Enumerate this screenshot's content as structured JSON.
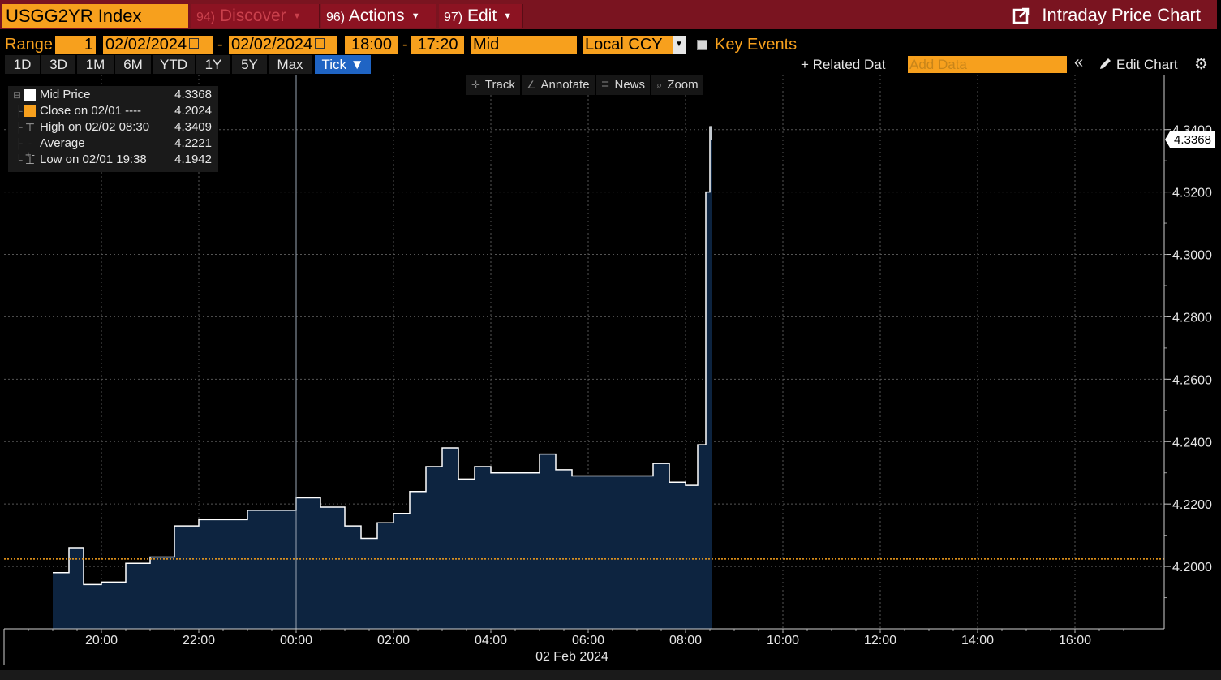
{
  "security": "USGG2YR Index",
  "menu": {
    "discover_num": "94)",
    "discover_label": "Discover",
    "actions_num": "96)",
    "actions_label": "Actions",
    "edit_num": "97)",
    "edit_label": "Edit"
  },
  "title": "Intraday Price Chart",
  "range": {
    "label": "Range",
    "count": "1",
    "start_date": "02/02/2024",
    "end_date": "02/02/2024",
    "start_time": "18:00",
    "end_time": "17:20",
    "field": "Mid",
    "currency": "Local CCY",
    "key_events": "Key Events"
  },
  "periods": [
    "1D",
    "3D",
    "1M",
    "6M",
    "YTD",
    "1Y",
    "5Y",
    "Max"
  ],
  "tick_label": "Tick ▼",
  "right_tools": {
    "related": "+ Related Dat",
    "add_data_placeholder": "Add Data",
    "collapse": "«",
    "edit_chart": "Edit Chart",
    "settings_icon": "gear-icon"
  },
  "chart_tools": [
    {
      "icon": "✛",
      "label": "Track"
    },
    {
      "icon": "∠",
      "label": "Annotate"
    },
    {
      "icon": "≣",
      "label": "News"
    },
    {
      "icon": "⌕",
      "label": "Zoom"
    }
  ],
  "legend": [
    {
      "label": "Mid Price",
      "value": "4.3368"
    },
    {
      "label": "Close on 02/01 ----",
      "value": "4.2024"
    },
    {
      "label": "High on 02/02 08:30",
      "value": "4.3409"
    },
    {
      "label": "Average",
      "value": "4.2221"
    },
    {
      "label": "Low on 02/01 19:38",
      "value": "4.1942"
    }
  ],
  "colors": {
    "accent": "#f7a01d",
    "header": "#7a1420",
    "area_fill": "#0d2440",
    "line": "#ffffff",
    "close_line": "#f7a01d",
    "active": "#1f64c4"
  },
  "chart_data": {
    "type": "area",
    "series": [
      {
        "name": "Mid Price",
        "x": [
          "19:00",
          "19:20",
          "19:38",
          "20:00",
          "20:30",
          "21:00",
          "21:30",
          "22:00",
          "22:30",
          "23:00",
          "23:30",
          "00:00",
          "00:30",
          "01:00",
          "01:20",
          "01:40",
          "02:00",
          "02:20",
          "02:40",
          "03:00",
          "03:20",
          "03:40",
          "04:00",
          "04:30",
          "05:00",
          "05:20",
          "05:40",
          "06:00",
          "06:30",
          "07:00",
          "07:20",
          "07:40",
          "08:00",
          "08:15",
          "08:25",
          "08:30",
          "08:32"
        ],
        "y": [
          4.198,
          4.206,
          4.1942,
          4.195,
          4.201,
          4.203,
          4.213,
          4.215,
          4.215,
          4.218,
          4.218,
          4.222,
          4.219,
          4.213,
          4.209,
          4.214,
          4.217,
          4.224,
          4.232,
          4.238,
          4.228,
          4.232,
          4.23,
          4.23,
          4.236,
          4.231,
          4.229,
          4.229,
          4.229,
          4.229,
          4.233,
          4.227,
          4.226,
          4.239,
          4.32,
          4.3409,
          4.3368
        ]
      }
    ],
    "close_value": 4.2024,
    "last_value": "4.3368",
    "x_ticks": [
      "20:00",
      "22:00",
      "00:00",
      "02:00",
      "04:00",
      "06:00",
      "08:00",
      "10:00",
      "12:00",
      "14:00",
      "16:00"
    ],
    "x_date_label": "02 Feb 2024",
    "y_ticks": [
      "4.2000",
      "4.2200",
      "4.2400",
      "4.2600",
      "4.2800",
      "4.3000",
      "4.3200",
      "4.3400"
    ],
    "y_tick_values": [
      4.2,
      4.22,
      4.24,
      4.26,
      4.28,
      4.3,
      4.32,
      4.34
    ],
    "x_range": [
      "18:00",
      "17:20"
    ],
    "ylim": [
      4.18,
      4.3433
    ],
    "grid": true
  }
}
